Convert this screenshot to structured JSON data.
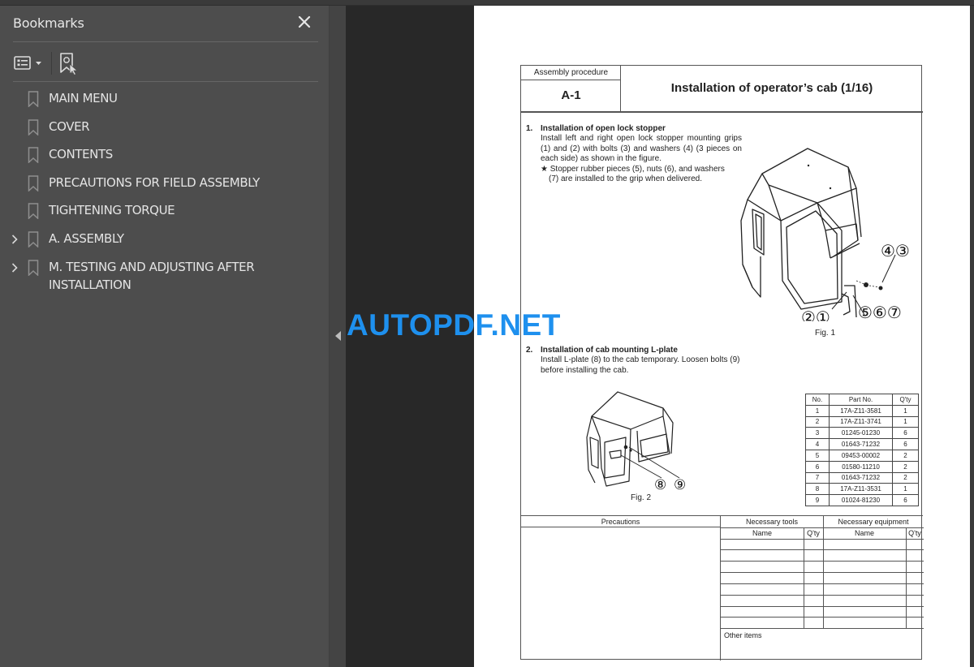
{
  "sidebar": {
    "title": "Bookmarks",
    "close_icon": "close-icon",
    "toolbar": {
      "options_icon": "bookmark-options-icon",
      "add_bookmark_icon": "add-bookmark-icon"
    },
    "items": [
      {
        "label": "MAIN MENU",
        "expandable": false
      },
      {
        "label": "COVER",
        "expandable": false
      },
      {
        "label": "CONTENTS",
        "expandable": false
      },
      {
        "label": "PRECAUTIONS FOR FIELD ASSEMBLY",
        "expandable": false
      },
      {
        "label": "TIGHTENING TORQUE",
        "expandable": false
      },
      {
        "label": "A. ASSEMBLY",
        "expandable": true
      },
      {
        "label": "M. TESTING AND ADJUSTING AFTER INSTALLATION",
        "expandable": true
      }
    ]
  },
  "watermark": "AUTOPDF.NET",
  "document": {
    "header": {
      "procedure_label": "Assembly procedure",
      "code": "A-1",
      "title": "Installation of operator’s cab (1/16)"
    },
    "steps": [
      {
        "num": "1.",
        "title": "Installation of open lock stopper",
        "body": "Install left and right open lock stopper mounting grips (1) and (2) with bolts (3) and washers (4) (3 pieces on each side) as shown in the figure.",
        "note_line1": "★ Stopper rubber pieces (5), nuts (6), and washers",
        "note_line2": "(7) are installed to the grip when delivered."
      },
      {
        "num": "2.",
        "title": "Installation of cab mounting L-plate",
        "body": "Install L-plate (8) to the cab temporary.  Loosen bolts (9) before installing the cab."
      }
    ],
    "figures": [
      {
        "caption": "Fig. 1",
        "callouts": [
          "②①",
          "④③",
          "⑤⑥⑦"
        ]
      },
      {
        "caption": "Fig. 2",
        "callouts": [
          "⑧",
          "⑨"
        ]
      }
    ],
    "parts_table": {
      "headers": [
        "No.",
        "Part No.",
        "Q'ty"
      ],
      "rows": [
        [
          "1",
          "17A-Z11-3581",
          "1"
        ],
        [
          "2",
          "17A-Z11-3741",
          "1"
        ],
        [
          "3",
          "01245-01230",
          "6"
        ],
        [
          "4",
          "01643-71232",
          "6"
        ],
        [
          "5",
          "09453-00002",
          "2"
        ],
        [
          "6",
          "01580-11210",
          "2"
        ],
        [
          "7",
          "01643-71232",
          "2"
        ],
        [
          "8",
          "17A-Z11-3531",
          "1"
        ],
        [
          "9",
          "01024-81230",
          "6"
        ]
      ]
    },
    "footer": {
      "precautions": "Precautions",
      "tools": "Necessary tools",
      "equipment": "Necessary equipment",
      "name": "Name",
      "qty": "Q'ty",
      "other_items": "Other items"
    }
  }
}
